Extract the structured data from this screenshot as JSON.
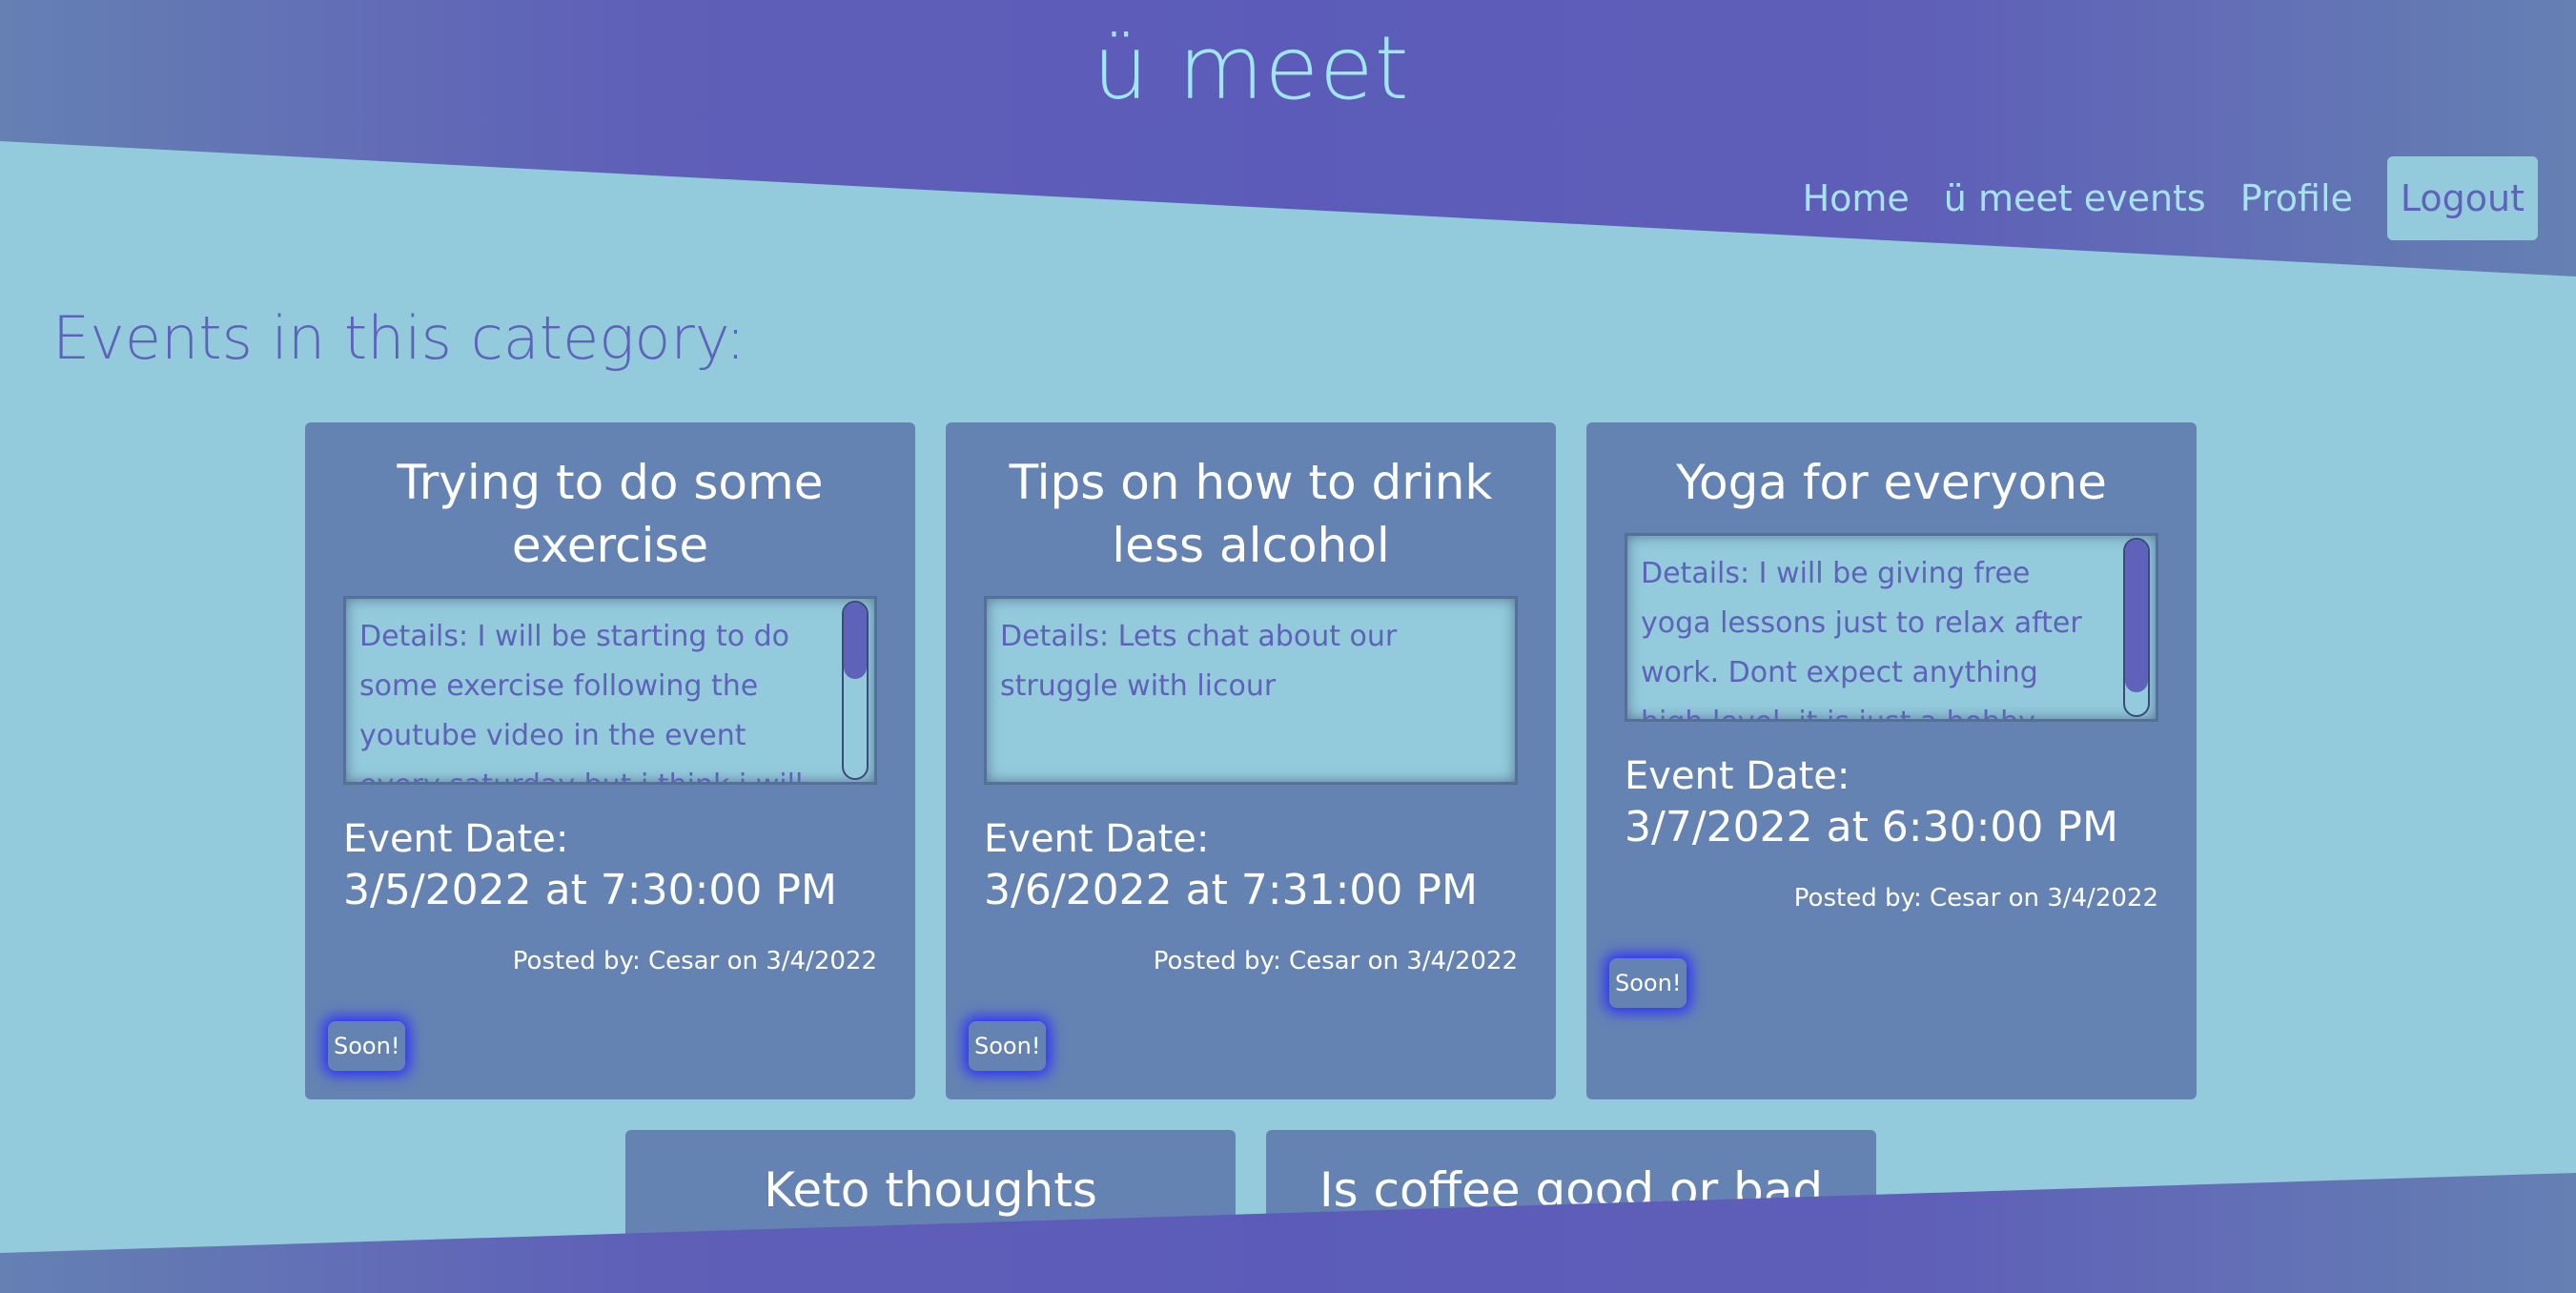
{
  "header": {
    "brand": "ü meet",
    "nav": {
      "home": "Home",
      "events": "ü meet events",
      "profile": "Profile",
      "logout": "Logout"
    }
  },
  "main": {
    "heading": "Events in this category:",
    "date_label": "Event Date:",
    "events": [
      {
        "title": "Trying to do some exercise",
        "details": "Details: I will be starting to do some exercise following the youtube video in the event every saturday but i think i will be more motivated if i",
        "date": "3/5/2022 at 7:30:00 PM",
        "posted": "Posted by: Cesar on 3/4/2022",
        "badge": "Soon!"
      },
      {
        "title": "Tips on how to drink less alcohol",
        "details": "Details: Lets chat about our struggle with licour",
        "date": "3/6/2022 at 7:31:00 PM",
        "posted": "Posted by: Cesar on 3/4/2022",
        "badge": "Soon!"
      },
      {
        "title": "Yoga for everyone",
        "details": "Details: I will be giving free yoga lessons just to relax after work. Dont expect anything high level, it is just a hobby",
        "date": "3/7/2022 at 6:30:00 PM",
        "posted": "Posted by: Cesar on 3/4/2022",
        "badge": "Soon!"
      },
      {
        "title": "Keto thoughts"
      },
      {
        "title": "Is coffee good or bad for"
      }
    ]
  },
  "colors": {
    "header_purple": "#5c5bb9",
    "page_background": "#93cbdd",
    "card_background": "#6483b3",
    "accent_text": "#5f62b9",
    "brand_text": "#9fe6f0",
    "badge_glow": "#2f30ff"
  }
}
